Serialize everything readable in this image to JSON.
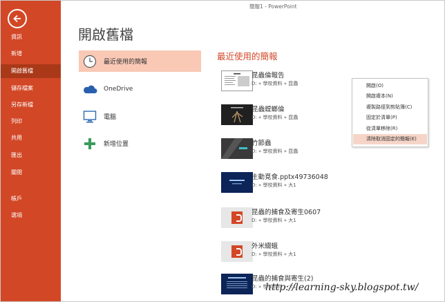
{
  "app_title": "簡報1 - PowerPoint",
  "sidebar": {
    "items": [
      {
        "label": "資訊"
      },
      {
        "label": "新增"
      },
      {
        "label": "開啟舊檔"
      },
      {
        "label": "儲存檔案"
      },
      {
        "label": "另存新檔"
      },
      {
        "label": "列印"
      },
      {
        "label": "共用"
      },
      {
        "label": "匯出"
      },
      {
        "label": "關閉"
      },
      {
        "label": "帳戶"
      },
      {
        "label": "選項"
      }
    ]
  },
  "page_title": "開啟舊檔",
  "places": [
    {
      "label": "最近使用的簡報",
      "icon": "clock-icon"
    },
    {
      "label": "OneDrive",
      "icon": "cloud-icon"
    },
    {
      "label": "電腦",
      "icon": "computer-icon"
    },
    {
      "label": "新增位置",
      "icon": "plus-icon"
    }
  ],
  "recent": {
    "title": "最近使用的簡報",
    "files": [
      {
        "name": "昆蟲倫報告",
        "path": "D: » 學校資料 » 昆蟲"
      },
      {
        "name": "昆蟲螳螂倫",
        "path": "D: » 學校資料 » 昆蟲"
      },
      {
        "name": "竹節蟲",
        "path": "D: » 學校資料 » 昆蟲"
      },
      {
        "name": "主動覓食.pptx49736048",
        "path": "D: » 學校資料 » 大1"
      },
      {
        "name": "昆蟲的捕食及寄生0607",
        "path": "D: » 學校資料 » 大1"
      },
      {
        "name": "外米綴蛾",
        "path": "D: » 學校資料 » 大1"
      },
      {
        "name": "昆蟲的捕食與寄生(2)",
        "path": "D: » 學校資料 » 大1"
      }
    ]
  },
  "context_menu": {
    "items": [
      {
        "label": "開啟(O)"
      },
      {
        "label": "開啟複本(N)"
      },
      {
        "label": "複製路徑到剪貼簿(C)"
      },
      {
        "label": "固定於清單(P)"
      },
      {
        "label": "從清單移除(R)"
      },
      {
        "label": "清除取消固定的簡報(E)"
      }
    ]
  },
  "watermark": "http://learning-sky.blogspot.tw/",
  "colors": {
    "accent": "#d24726",
    "accent_dark": "#a93918",
    "selected_place": "#f9c9b6",
    "menu_highlight": "#f6d5c8"
  }
}
